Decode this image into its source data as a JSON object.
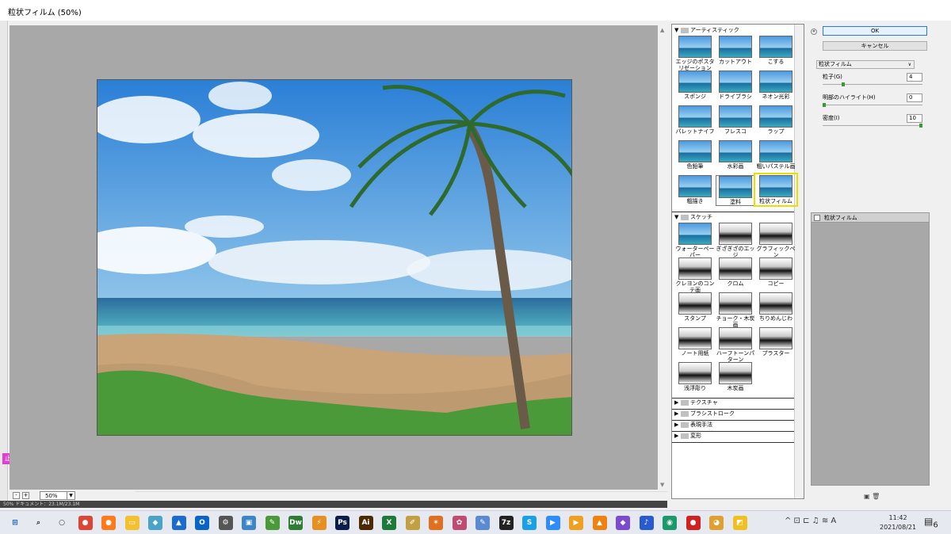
{
  "window": {
    "title": "粒状フィルム (50%)"
  },
  "ruler": {
    "stamp": "止"
  },
  "zoom": {
    "value": "50%",
    "minus": "-",
    "plus": "+"
  },
  "status": {
    "text": "50%   ドキュメント：23.1M/23.1M"
  },
  "gallery": {
    "artistic": {
      "label": "アーティスティック",
      "items": [
        "エッジのポスタリゼーション",
        "カットアウト",
        "こする",
        "スポンジ",
        "ドライブラシ",
        "ネオン光彩",
        "パレットナイフ",
        "フレスコ",
        "ラップ",
        "色鉛筆",
        "水彩画",
        "粗いパステル画",
        "粗描き",
        "塗料",
        "粒状フィルム"
      ]
    },
    "sketch": {
      "label": "スケッチ",
      "items": [
        "ウォーターペーパー",
        "ぎざぎざのエッジ",
        "グラフィックペン",
        "クレヨンのコンテ画",
        "クロム",
        "コピー",
        "スタンプ",
        "チョーク・木炭画",
        "ちりめんじわ",
        "ノート用紙",
        "ハーフトーンパターン",
        "プラスター",
        "浅浮彫り",
        "木炭画"
      ]
    },
    "others": [
      "テクスチャ",
      "ブラシストローク",
      "表現手法",
      "変形"
    ]
  },
  "panel": {
    "ok": "OK",
    "cancel": "キャンセル",
    "filter": "粒状フィルム",
    "params": [
      {
        "label": "粒子(G)",
        "value": "4",
        "frac": 0.2
      },
      {
        "label": "明部のハイライト(H)",
        "value": "0",
        "frac": 0.0
      },
      {
        "label": "密度(I)",
        "value": "10",
        "frac": 1.0
      }
    ],
    "layer": "粒状フィルム"
  },
  "taskbar": {
    "apps": [
      {
        "name": "windows-start",
        "glyph": "⊞",
        "color": "#0a5cc4"
      },
      {
        "name": "search",
        "glyph": "⌕",
        "color": "#333"
      },
      {
        "name": "task-view",
        "glyph": "○",
        "color": "#333"
      },
      {
        "name": "chrome",
        "glyph": "●",
        "color": "#dd4433"
      },
      {
        "name": "firefox",
        "glyph": "●",
        "color": "#ff7a18"
      },
      {
        "name": "explorer",
        "glyph": "▭",
        "color": "#f5c030"
      },
      {
        "name": "app",
        "glyph": "◆",
        "color": "#4aa3c8"
      },
      {
        "name": "photos",
        "glyph": "▲",
        "color": "#1a6bd0"
      },
      {
        "name": "outlook",
        "glyph": "O",
        "color": "#0a64c8"
      },
      {
        "name": "settings",
        "glyph": "⚙",
        "color": "#555"
      },
      {
        "name": "app2",
        "glyph": "▣",
        "color": "#3a86c8"
      },
      {
        "name": "app3",
        "glyph": "✎",
        "color": "#4a9a3a"
      },
      {
        "name": "dreamweaver",
        "glyph": "Dw",
        "color": "#2e7d32"
      },
      {
        "name": "app4",
        "glyph": "⚡",
        "color": "#e59020"
      },
      {
        "name": "photoshop",
        "glyph": "Ps",
        "color": "#0b1e4a"
      },
      {
        "name": "illustrator",
        "glyph": "Ai",
        "color": "#4a2a00"
      },
      {
        "name": "excel",
        "glyph": "X",
        "color": "#1d7a3a"
      },
      {
        "name": "app5",
        "glyph": "✐",
        "color": "#c0a040"
      },
      {
        "name": "butterfly",
        "glyph": "✶",
        "color": "#e07020"
      },
      {
        "name": "app6",
        "glyph": "✿",
        "color": "#c04a70"
      },
      {
        "name": "app7",
        "glyph": "✎",
        "color": "#5a8ad0"
      },
      {
        "name": "7zip",
        "glyph": "7z",
        "color": "#222"
      },
      {
        "name": "skype",
        "glyph": "S",
        "color": "#1aa0e8"
      },
      {
        "name": "zoom",
        "glyph": "▶",
        "color": "#2d8cff"
      },
      {
        "name": "app8",
        "glyph": "▶",
        "color": "#f0a020"
      },
      {
        "name": "vlc",
        "glyph": "▲",
        "color": "#f08010"
      },
      {
        "name": "app9",
        "glyph": "◆",
        "color": "#7a4ad0"
      },
      {
        "name": "music",
        "glyph": "♪",
        "color": "#2a5ad0"
      },
      {
        "name": "app10",
        "glyph": "◉",
        "color": "#1a9a6a"
      },
      {
        "name": "record",
        "glyph": "●",
        "color": "#d02020"
      },
      {
        "name": "app11",
        "glyph": "◕",
        "color": "#e0a030"
      },
      {
        "name": "app12",
        "glyph": "◩",
        "color": "#f0c020"
      }
    ],
    "systray": "^ ⊡ ⊏ ♫ ≋ A",
    "time": "11:42",
    "date": "2021/08/21",
    "notif_count": "6"
  },
  "colors": {
    "selection_outline": "#e8e000",
    "ok_border": "#2a7bd8",
    "preview_bg": "#a8a8a8"
  }
}
